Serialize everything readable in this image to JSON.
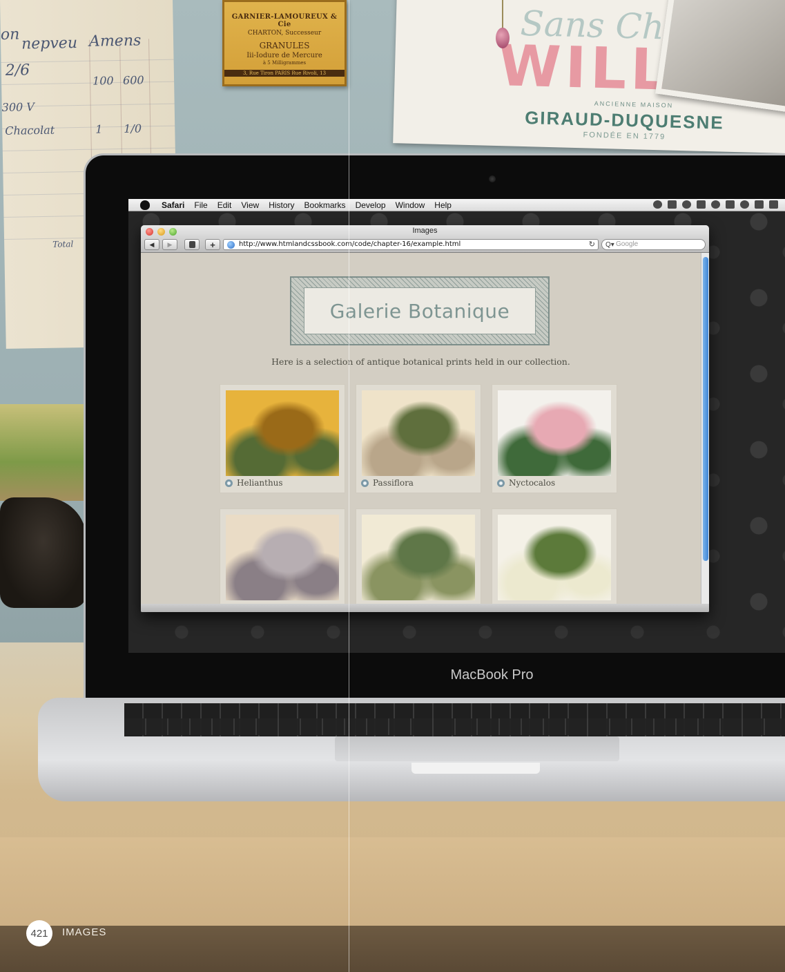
{
  "backdrop": {
    "ledger_lines": [
      "on",
      "nepveu",
      "Amens",
      "2/6",
      "100",
      "600",
      "300 V",
      "Chacolat",
      "1",
      "1/0",
      "Total"
    ],
    "label": {
      "line1": "GARNIER-LAMOUREUX & Cie",
      "line2": "CHARTON, Successeur",
      "line3": "GRANULES",
      "line4": "Iii-Iodure de Mercure",
      "line5": "à 5 Milligrammes",
      "line6": "3, Rue Tiron PARIS Rue Rivoli, 13"
    },
    "poster": {
      "script": "Sans Chic",
      "big": "WILLI",
      "small": "ANCIENNE MAISON",
      "name": "GIRAUD-DUQUESNE",
      "date": "FONDÉE EN 1779"
    }
  },
  "laptop": {
    "brand": "MacBook Pro"
  },
  "menubar": {
    "app": "Safari",
    "items": [
      "File",
      "Edit",
      "View",
      "History",
      "Bookmarks",
      "Develop",
      "Window",
      "Help"
    ]
  },
  "browser": {
    "title": "Images",
    "url": "http://www.htmlandcssbook.com/code/chapter-16/example.html",
    "search_placeholder": "Google",
    "back_glyph": "◀",
    "forward_glyph": "▶",
    "add_glyph": "+",
    "reload_glyph": "↻",
    "search_glyph": "Q▾"
  },
  "page": {
    "heading": "Galerie Botanique",
    "intro": "Here is a selection of antique botanical prints held in our collection.",
    "gallery": [
      {
        "caption": "Helianthus",
        "palette": [
          "#e7b33c",
          "#9a6a18",
          "#556b35"
        ]
      },
      {
        "caption": "Passiflora",
        "palette": [
          "#efe3c9",
          "#5f6f3d",
          "#b9a68a"
        ]
      },
      {
        "caption": "Nyctocalos",
        "palette": [
          "#f3f1ec",
          "#e7a9b3",
          "#3f6a3a"
        ]
      },
      {
        "caption": "",
        "palette": [
          "#eadcc6",
          "#b7aeb2",
          "#8a7f86"
        ]
      },
      {
        "caption": "",
        "palette": [
          "#f1ead5",
          "#5f7748",
          "#8a9461"
        ]
      },
      {
        "caption": "",
        "palette": [
          "#f4f1e7",
          "#5c7a3a",
          "#ece9cf"
        ]
      }
    ]
  },
  "footer": {
    "page_number": "421",
    "section": "IMAGES"
  }
}
